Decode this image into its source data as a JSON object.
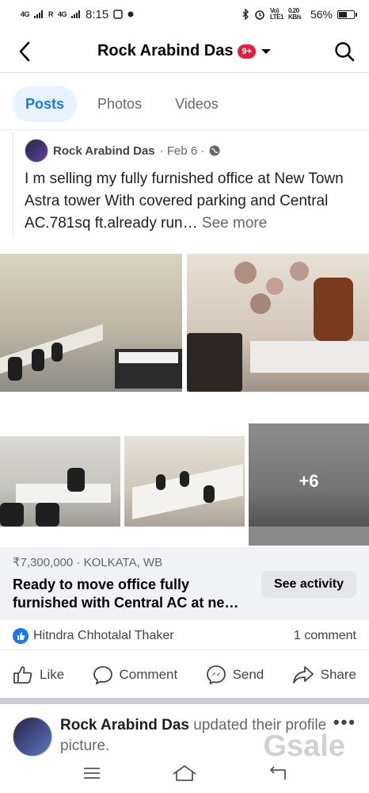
{
  "status_bar": {
    "sig1": "4G",
    "sig2": "R",
    "sig3": "4G",
    "time": "8:15",
    "net_speed": "0.20 KB/s",
    "battery_percent": "56%",
    "battery_level": 0.56
  },
  "header": {
    "title": "Rock Arabind Das",
    "badge": "9+",
    "back_icon": "chevron-left-icon",
    "search_icon": "search-icon"
  },
  "tabs": [
    {
      "label": "Posts",
      "active": true
    },
    {
      "label": "Photos",
      "active": false
    },
    {
      "label": "Videos",
      "active": false
    }
  ],
  "post": {
    "author": "Rock Arabind Das",
    "date": "· Feb 6 ·",
    "text": "I m selling my fully furnished office at  New Town Astra tower With covered parking and Central AC.781sq ft.already run…",
    "see_more": "See more",
    "more_photos": "+6"
  },
  "listing": {
    "meta": "₹7,300,000 · KOLKATA, WB",
    "title": "Ready to move office fully furnished with Central AC at ne…",
    "see_activity": "See activity"
  },
  "reactions": {
    "reactor": "Hitndra Chhotalal Thaker",
    "comment_count": "1 comment"
  },
  "actions": {
    "like": "Like",
    "comment": "Comment",
    "send": "Send",
    "share": "Share"
  },
  "next_post": {
    "author": "Rock Arabind Das",
    "action": "updated their profile picture."
  },
  "watermark": "Gsale",
  "colors": {
    "accent": "#1877f2",
    "badge": "#e41e3f",
    "tab_active_bg": "#e7f3ff"
  }
}
